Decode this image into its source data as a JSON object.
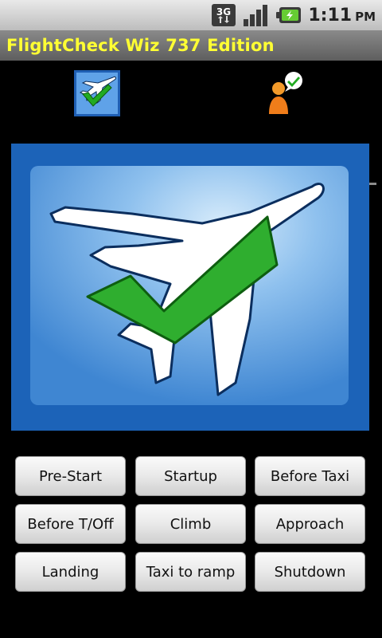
{
  "status_bar": {
    "network": "3G",
    "time": "1:11",
    "ampm": "PM",
    "icons": [
      "3g-data-icon",
      "signal-strength-icon",
      "battery-charging-icon"
    ]
  },
  "app": {
    "title": "FlightCheck Wiz 737 Edition"
  },
  "tabs": [
    {
      "icon": "airplane-check-icon",
      "selected": true
    },
    {
      "icon": "person-check-icon",
      "selected": false
    }
  ],
  "hero": {
    "icon": "airplane-checkmark-logo",
    "colors": {
      "background": "#1c63b8",
      "plane": "#ffffff",
      "check": "#22aa22"
    }
  },
  "buttons": [
    {
      "label": "Pre-Start"
    },
    {
      "label": "Startup"
    },
    {
      "label": "Before Taxi"
    },
    {
      "label": "Before T/Off"
    },
    {
      "label": "Climb"
    },
    {
      "label": "Approach"
    },
    {
      "label": "Landing"
    },
    {
      "label": "Taxi to ramp"
    },
    {
      "label": "Shutdown"
    }
  ],
  "colors": {
    "title_text": "#ffff33",
    "title_bar": "#707070",
    "status_bar": "#d4d4d4",
    "button_face": "#e6e6e6"
  }
}
